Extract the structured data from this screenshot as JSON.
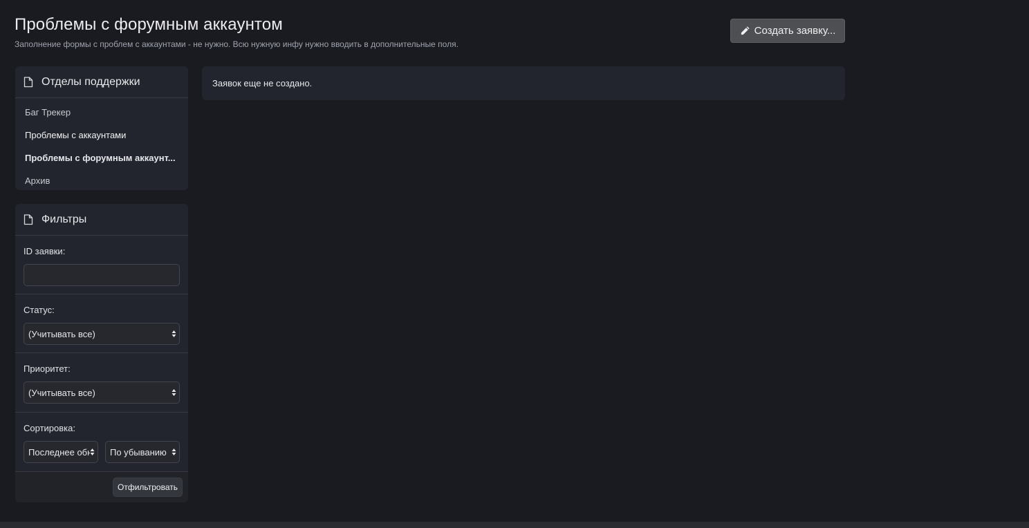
{
  "header": {
    "title": "Проблемы с форумным аккаунтом",
    "subtitle": "Заполнение формы с проблем с аккаунтами - не нужно. Всю нужную инфу нужно вводить в дополнительные поля.",
    "create_button_label": "Создать заявку..."
  },
  "departments": {
    "title": "Отделы поддержки",
    "items": [
      {
        "label": "Баг Трекер"
      },
      {
        "label": "Проблемы с аккаунтами"
      },
      {
        "label": "Проблемы с форумным аккаунт..."
      },
      {
        "label": "Архив"
      }
    ],
    "active_index": 2
  },
  "filters": {
    "title": "Фильтры",
    "ticket_id_label": "ID заявки:",
    "ticket_id_value": "",
    "status_label": "Статус:",
    "status_value": "(Учитывать все)",
    "priority_label": "Приоритет:",
    "priority_value": "(Учитывать все)",
    "sort_label": "Сортировка:",
    "sort_field_value": "Последнее обн",
    "sort_order_value": "По убыванию",
    "submit_label": "Отфильтровать"
  },
  "main": {
    "empty_message": "Заявок еще не создано."
  },
  "colors": {
    "background": "#1a1b20",
    "panel": "#22252d",
    "button": "#4e4f53"
  }
}
